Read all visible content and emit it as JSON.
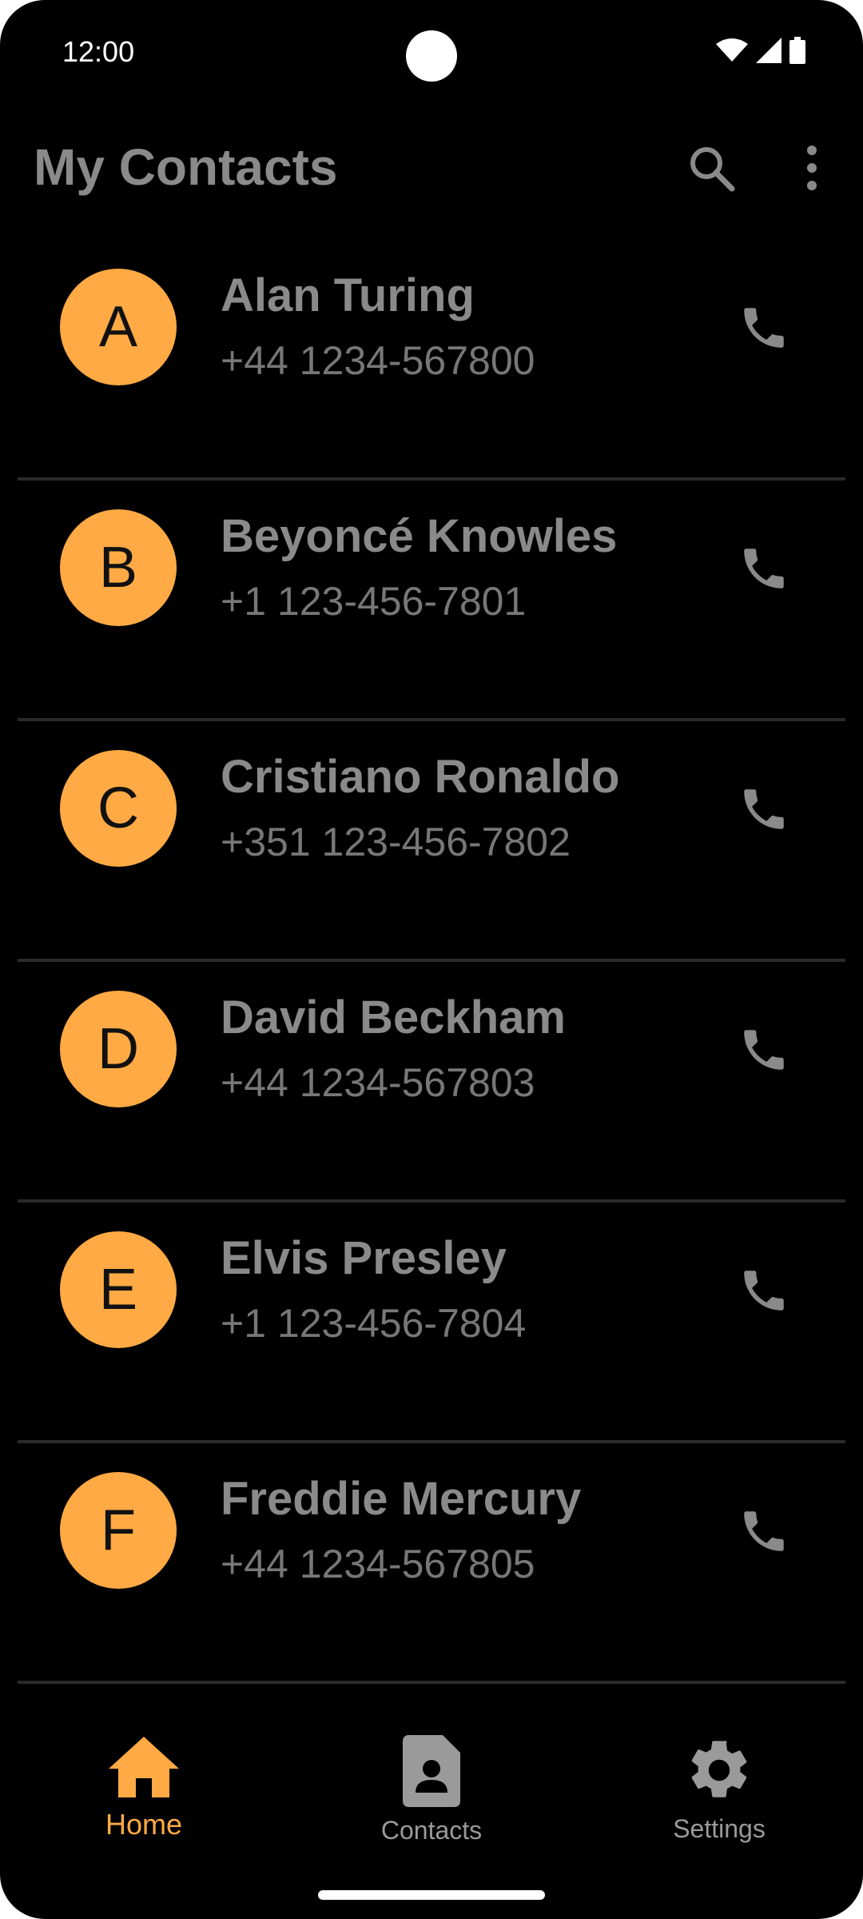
{
  "status_bar": {
    "time": "12:00",
    "icons": [
      "wifi-icon",
      "signal-icon",
      "battery-icon"
    ]
  },
  "app_bar": {
    "title": "My Contacts",
    "actions": [
      "search-icon",
      "more-vert-icon"
    ]
  },
  "contacts": [
    {
      "initial": "A",
      "name": "Alan Turing",
      "phone": "+44 1234-567800"
    },
    {
      "initial": "B",
      "name": "Beyoncé Knowles",
      "phone": "+1 123-456-7801"
    },
    {
      "initial": "C",
      "name": "Cristiano Ronaldo",
      "phone": "+351 123-456-7802"
    },
    {
      "initial": "D",
      "name": "David Beckham",
      "phone": "+44 1234-567803"
    },
    {
      "initial": "E",
      "name": "Elvis Presley",
      "phone": "+1 123-456-7804"
    },
    {
      "initial": "F",
      "name": "Freddie Mercury",
      "phone": "+44 1234-567805"
    }
  ],
  "bottom_nav": {
    "items": [
      {
        "label": "Home",
        "icon": "home-icon",
        "selected": true
      },
      {
        "label": "Contacts",
        "icon": "contact-card-icon",
        "selected": false
      },
      {
        "label": "Settings",
        "icon": "gear-icon",
        "selected": false
      }
    ]
  },
  "colors": {
    "accent": "#ffaa44",
    "background": "#000000",
    "text": "#8a8a8a",
    "divider": "#2a2a2a"
  }
}
